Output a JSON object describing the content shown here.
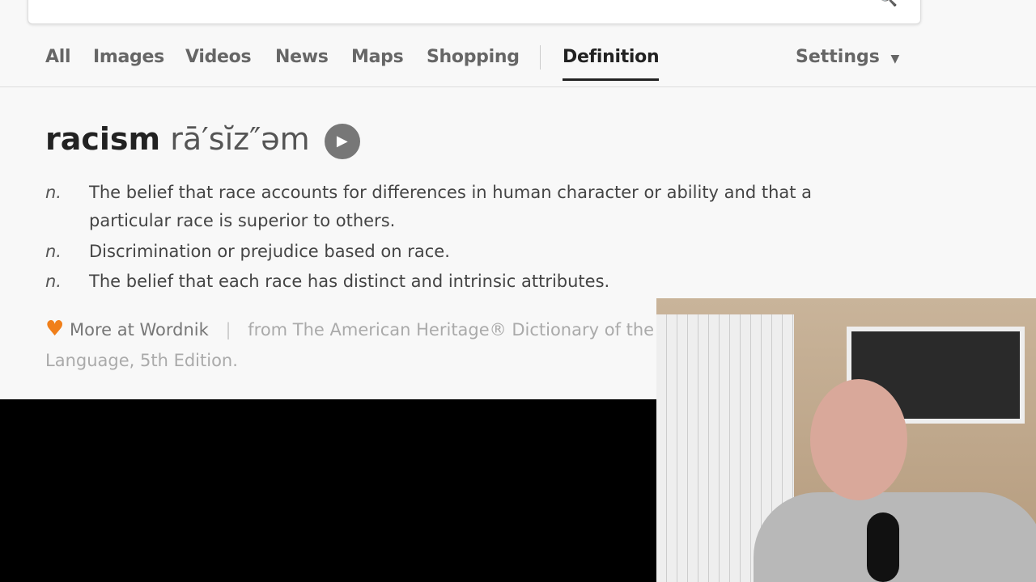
{
  "search": {
    "icon": "search-icon"
  },
  "tabs": [
    {
      "label": "All"
    },
    {
      "label": "Images"
    },
    {
      "label": "Videos"
    },
    {
      "label": "News"
    },
    {
      "label": "Maps"
    },
    {
      "label": "Shopping"
    },
    {
      "label": "Definition",
      "active": true
    }
  ],
  "settings": {
    "label": "Settings",
    "icon": "caret-down-icon"
  },
  "definition": {
    "word": "racism",
    "pronunciation": "rā′sĭz″əm",
    "play_icon": "play-icon",
    "senses": [
      {
        "pos": "n.",
        "text": "The belief that race accounts for differences in human character or ability and that a particular race is superior to others."
      },
      {
        "pos": "n.",
        "text": "Discrimination or prejudice based on race."
      },
      {
        "pos": "n.",
        "text": "The belief that each race has distinct and intrinsic attributes."
      }
    ]
  },
  "source": {
    "more_label": "More at Wordnik",
    "attribution": "from The American Heritage® Dictionary of the English Language, 5th Edition.",
    "heart_color": "#f07f1a"
  }
}
